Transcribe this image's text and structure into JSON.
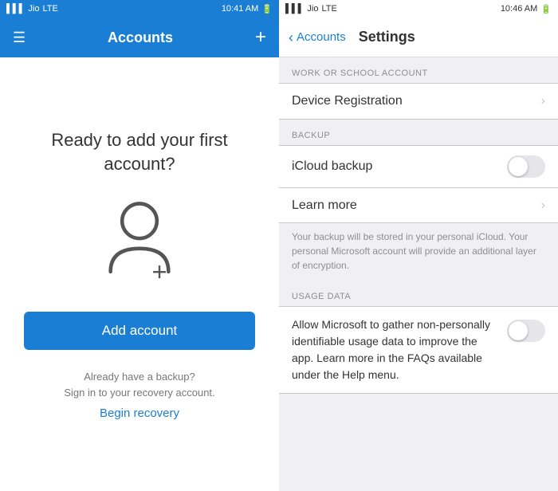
{
  "left": {
    "status_bar": {
      "carrier": "Jio",
      "network": "LTE",
      "time": "10:41 AM"
    },
    "navbar": {
      "title": "Accounts",
      "menu_label": "☰",
      "plus_label": "+"
    },
    "welcome_heading": "Ready to add your first account?",
    "add_account_label": "Add account",
    "recovery_line1": "Already have a backup?",
    "recovery_line2": "Sign in to your recovery account.",
    "begin_recovery_label": "Begin recovery"
  },
  "right": {
    "status_bar": {
      "carrier": "Jio",
      "network": "LTE",
      "time": "10:46 AM"
    },
    "navbar": {
      "back_label": "Accounts",
      "title": "Settings"
    },
    "sections": [
      {
        "header": "Work or School Account",
        "items": [
          {
            "label": "Device Registration",
            "type": "chevron"
          }
        ]
      },
      {
        "header": "Backup",
        "items": [
          {
            "label": "iCloud backup",
            "type": "toggle",
            "value": false
          },
          {
            "label": "Learn more",
            "type": "chevron"
          }
        ],
        "info": "Your backup will be stored in your personal iCloud. Your personal Microsoft account will provide an additional layer of encryption."
      },
      {
        "header": "Usage Data",
        "usage_text": "Allow Microsoft to gather non-personally identifiable usage data to improve the app. Learn more in the FAQs available under the Help menu.",
        "toggle_value": false
      }
    ]
  }
}
